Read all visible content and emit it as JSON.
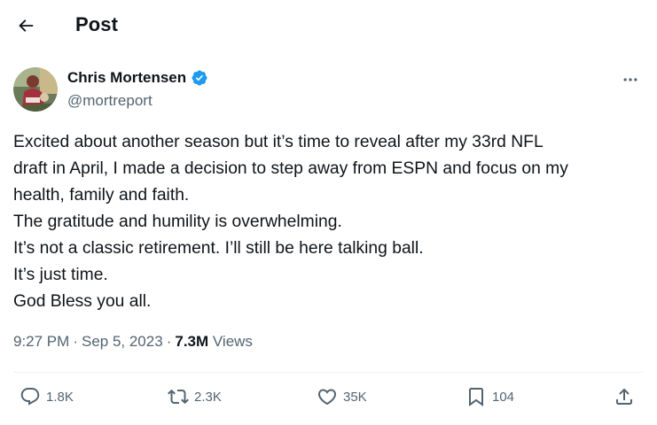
{
  "header": {
    "title": "Post"
  },
  "author": {
    "name": "Chris Mortensen",
    "handle": "@mortreport",
    "verified": true
  },
  "tweet": {
    "lines": [
      "Excited about another season but it’s time to reveal after my 33rd NFL",
      "draft in April, I made a decision to step away from ESPN and focus on my",
      "health, family and faith.",
      "The gratitude and humility is overwhelming.",
      "It’s not a classic retirement. I’ll still be here talking ball.",
      "It’s just time.",
      "God Bless you all."
    ]
  },
  "meta": {
    "time": "9:27 PM",
    "date": "Sep 5, 2023",
    "views": "7.3M",
    "views_label": "Views",
    "separator": "·"
  },
  "actions": {
    "replies": "1.8K",
    "reposts": "2.3K",
    "likes": "35K",
    "bookmarks": "104"
  },
  "colors": {
    "text": "#0f1419",
    "muted": "#536471",
    "verified": "#1d9bf0",
    "divider": "#eff3f4"
  },
  "icons": [
    "back-arrow-icon",
    "verified-badge-icon",
    "more-icon",
    "reply-icon",
    "repost-icon",
    "like-icon",
    "bookmark-icon",
    "share-icon"
  ]
}
